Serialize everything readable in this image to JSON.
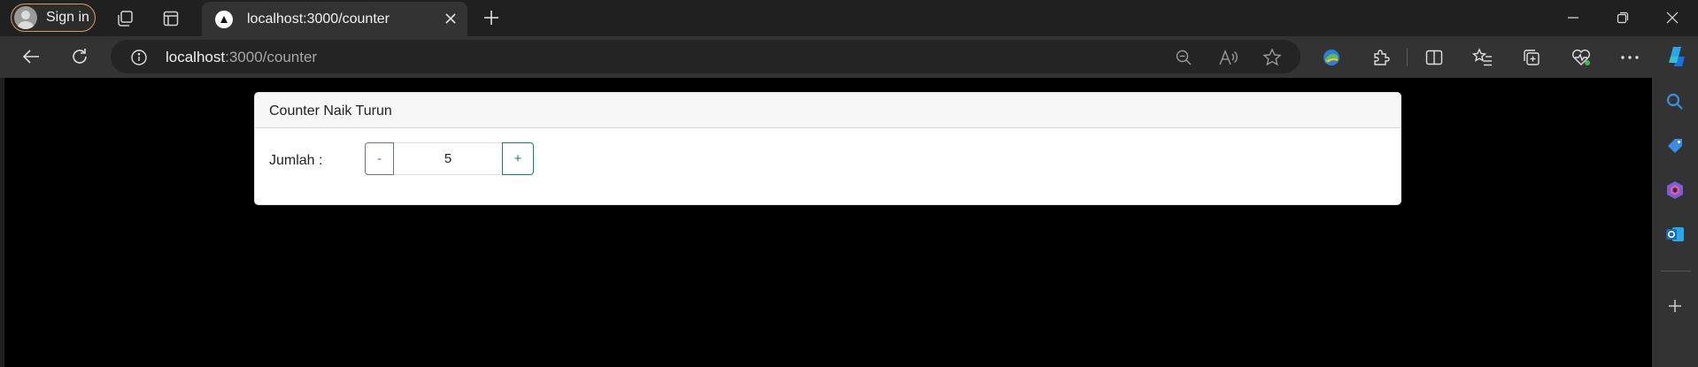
{
  "browser": {
    "profile_label": "Sign in",
    "tab": {
      "title": "localhost:3000/counter"
    },
    "address": {
      "host": "localhost",
      "path": ":3000/counter"
    },
    "accent_color": "#d99a5c"
  },
  "page": {
    "card_title": "Counter Naik Turun",
    "counter": {
      "label": "Jumlah :",
      "decrement_label": "-",
      "value": "5",
      "increment_label": "+"
    },
    "colors": {
      "increment": "#198754",
      "decrement": "#6c757d",
      "background": "#000000"
    }
  }
}
